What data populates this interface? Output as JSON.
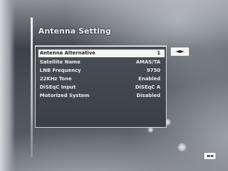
{
  "title": "Antenna Setting",
  "menu": {
    "items": [
      {
        "label": "Antenna Alternative",
        "value": "1",
        "selected": true
      },
      {
        "label": "Satellite Name",
        "value": "AMAS/TA",
        "selected": false
      },
      {
        "label": "LNB Frequency",
        "value": "9750",
        "selected": false
      },
      {
        "label": "22KHz Tone",
        "value": "Enabled",
        "selected": false
      },
      {
        "label": "DiSEqC Input",
        "value": "DiSEqC A",
        "selected": false
      },
      {
        "label": "Motorized System",
        "value": "Disabled",
        "selected": false
      }
    ]
  },
  "side_button": {
    "label": "◄►",
    "icon": "left-right-arrows-icon"
  },
  "corner_icon": {
    "icon": "menu-blocks-icon"
  },
  "colors": {
    "selected_row": "#f5f6f7",
    "panel": "#3f444a",
    "text": "#e9ebed"
  }
}
